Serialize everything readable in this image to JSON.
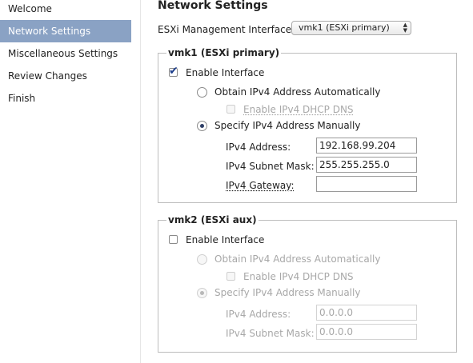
{
  "sidebar": {
    "items": [
      {
        "label": "Welcome",
        "active": false
      },
      {
        "label": "Network Settings",
        "active": true
      },
      {
        "label": "Miscellaneous Settings",
        "active": false
      },
      {
        "label": "Review Changes",
        "active": false
      },
      {
        "label": "Finish",
        "active": false
      }
    ]
  },
  "main": {
    "title": "Network Settings",
    "management_interface": {
      "label": "ESXi Management Interface:",
      "selected": "vmk1 (ESXi primary)"
    },
    "vmk1": {
      "legend": "vmk1 (ESXi primary)",
      "enable_label": "Enable Interface",
      "enable_checked": true,
      "obtain_auto_label": "Obtain IPv4 Address Automatically",
      "dhcp_dns_label": "Enable IPv4 DHCP DNS",
      "specify_manual_label": "Specify IPv4 Address Manually",
      "ipv4_address_label": "IPv4 Address:",
      "ipv4_address_value": "192.168.99.204",
      "subnet_mask_label": "IPv4 Subnet Mask:",
      "subnet_mask_value": "255.255.255.0",
      "gateway_label": "IPv4 Gateway:",
      "gateway_value": ""
    },
    "vmk2": {
      "legend": "vmk2 (ESXi aux)",
      "enable_label": "Enable Interface",
      "enable_checked": false,
      "obtain_auto_label": "Obtain IPv4 Address Automatically",
      "dhcp_dns_label": "Enable IPv4 DHCP DNS",
      "specify_manual_label": "Specify IPv4 Address Manually",
      "ipv4_address_label": "IPv4 Address:",
      "ipv4_address_value": "0.0.0.0",
      "subnet_mask_label": "IPv4 Subnet Mask:",
      "subnet_mask_value": "0.0.0.0"
    }
  }
}
